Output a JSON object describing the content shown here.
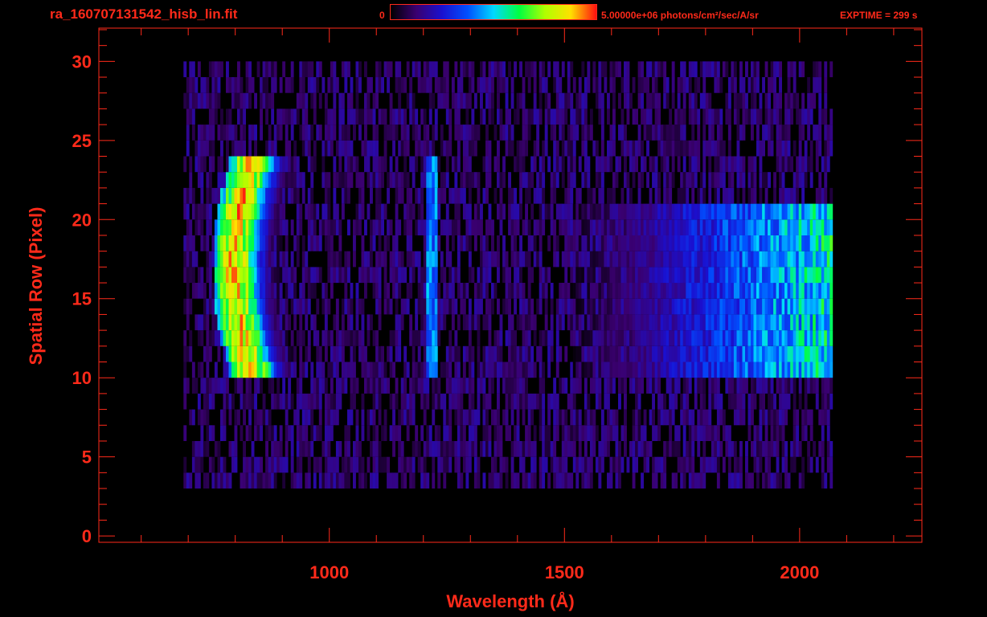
{
  "header": {
    "filename": "ra_160707131542_hisb_lin.fit",
    "colorbar_min": "0",
    "colorbar_max_value": "5.00000e+06",
    "colorbar_units": "photons/cm²/sec/A/sr",
    "exptime": "EXPTIME = 299 s"
  },
  "colors": {
    "axes": "#ff2a1a",
    "background": "#000000",
    "colormap": [
      "#000000",
      "#3a0070",
      "#1a10d0",
      "#0050ff",
      "#00d8ff",
      "#00ff40",
      "#b0ff00",
      "#ffe000",
      "#ff1010"
    ]
  },
  "chart_data": {
    "type": "heatmap",
    "xlabel": "Wavelength (Å)",
    "ylabel": "Spatial Row (Pixel)",
    "xlim": [
      510,
      2260
    ],
    "ylim": [
      -0.4,
      32.1
    ],
    "x_ticks": [
      1000,
      1500,
      2000
    ],
    "y_ticks": [
      0,
      5,
      10,
      15,
      20,
      25,
      30
    ],
    "colorbar_range": [
      0,
      5000000
    ],
    "data_extent": {
      "wavelength": [
        690,
        2070
      ],
      "rows": [
        3,
        30
      ]
    },
    "features": [
      {
        "wavelength_center": 830,
        "rows": [
          10,
          24
        ],
        "peak_fraction": 1.0
      },
      {
        "wavelength_center": 1216,
        "rows": [
          10,
          24
        ],
        "peak_fraction": 0.5
      },
      {
        "wavelength_range": [
          1650,
          2070
        ],
        "rows": [
          10,
          21
        ],
        "peak_fraction": 0.7
      }
    ]
  }
}
